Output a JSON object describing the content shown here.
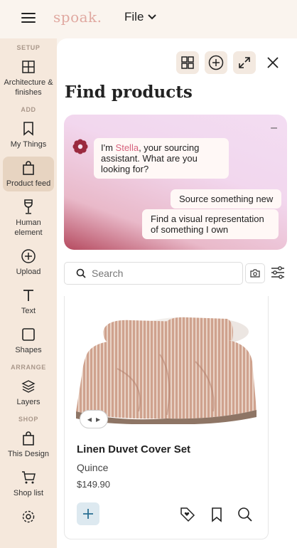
{
  "app": {
    "logo": "spoak.",
    "file_menu": "File"
  },
  "sidebar": {
    "sections": [
      "SETUP",
      "ADD",
      "ARRANGE",
      "SHOP"
    ],
    "items": [
      {
        "label": "Architecture & finishes",
        "icon": "grid-icon"
      },
      {
        "label": "My Things",
        "icon": "bookmark-icon"
      },
      {
        "label": "Product feed",
        "icon": "shopping-bag-icon"
      },
      {
        "label": "Human element",
        "icon": "wine-glass-icon"
      },
      {
        "label": "Upload",
        "icon": "plus-circle-icon"
      },
      {
        "label": "Text",
        "icon": "text-icon"
      },
      {
        "label": "Shapes",
        "icon": "square-icon"
      },
      {
        "label": "Layers",
        "icon": "layers-icon"
      },
      {
        "label": "This Design",
        "icon": "shopping-bag-icon"
      },
      {
        "label": "Shop list",
        "icon": "cart-icon"
      }
    ]
  },
  "panel": {
    "title": "Find products",
    "assistant": {
      "message_pre": "I'm ",
      "name": "Stella",
      "message_post": ", your sourcing assistant. What are you looking for?",
      "option1": "Source something new",
      "option2": "Find a visual representation of something I own",
      "minimize": "–"
    },
    "search": {
      "placeholder": "Search",
      "value": ""
    }
  },
  "product": {
    "name": "Linen Duvet Cover Set",
    "brand": "Quince",
    "price": "$149.90"
  },
  "colors": {
    "accent": "#d6617c",
    "sidebar_bg": "#f5e8dc",
    "active_bg": "#e7d4c1"
  }
}
